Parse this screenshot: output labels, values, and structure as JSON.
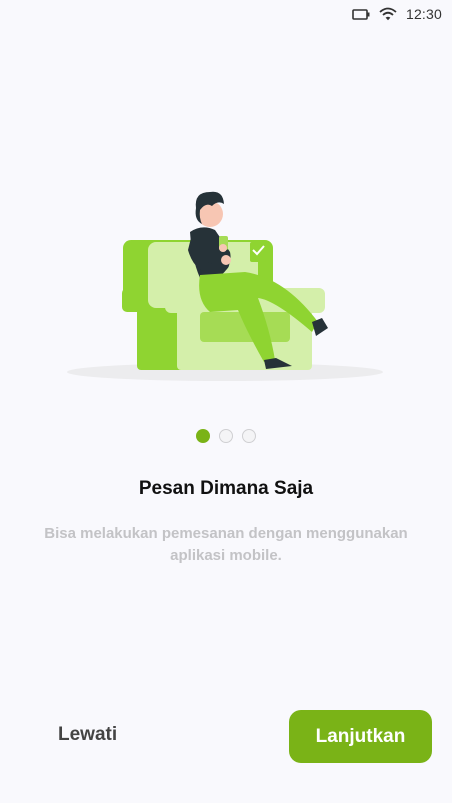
{
  "status_bar": {
    "time": "12:30",
    "icons": [
      "battery-icon",
      "wifi-icon"
    ]
  },
  "onboarding": {
    "illustration": "person-on-sofa-illustration",
    "pagination": {
      "total": 3,
      "active_index": 0
    },
    "title": "Pesan Dimana Saja",
    "description": "Bisa melakukan pemesanan dengan menggunakan aplikasi mobile."
  },
  "actions": {
    "skip_label": "Lewati",
    "next_label": "Lanjutkan"
  },
  "colors": {
    "accent": "#7ab317",
    "background": "#f9f9fd",
    "sofa_dark": "#8fd431",
    "sofa_light": "#d4efaa"
  }
}
